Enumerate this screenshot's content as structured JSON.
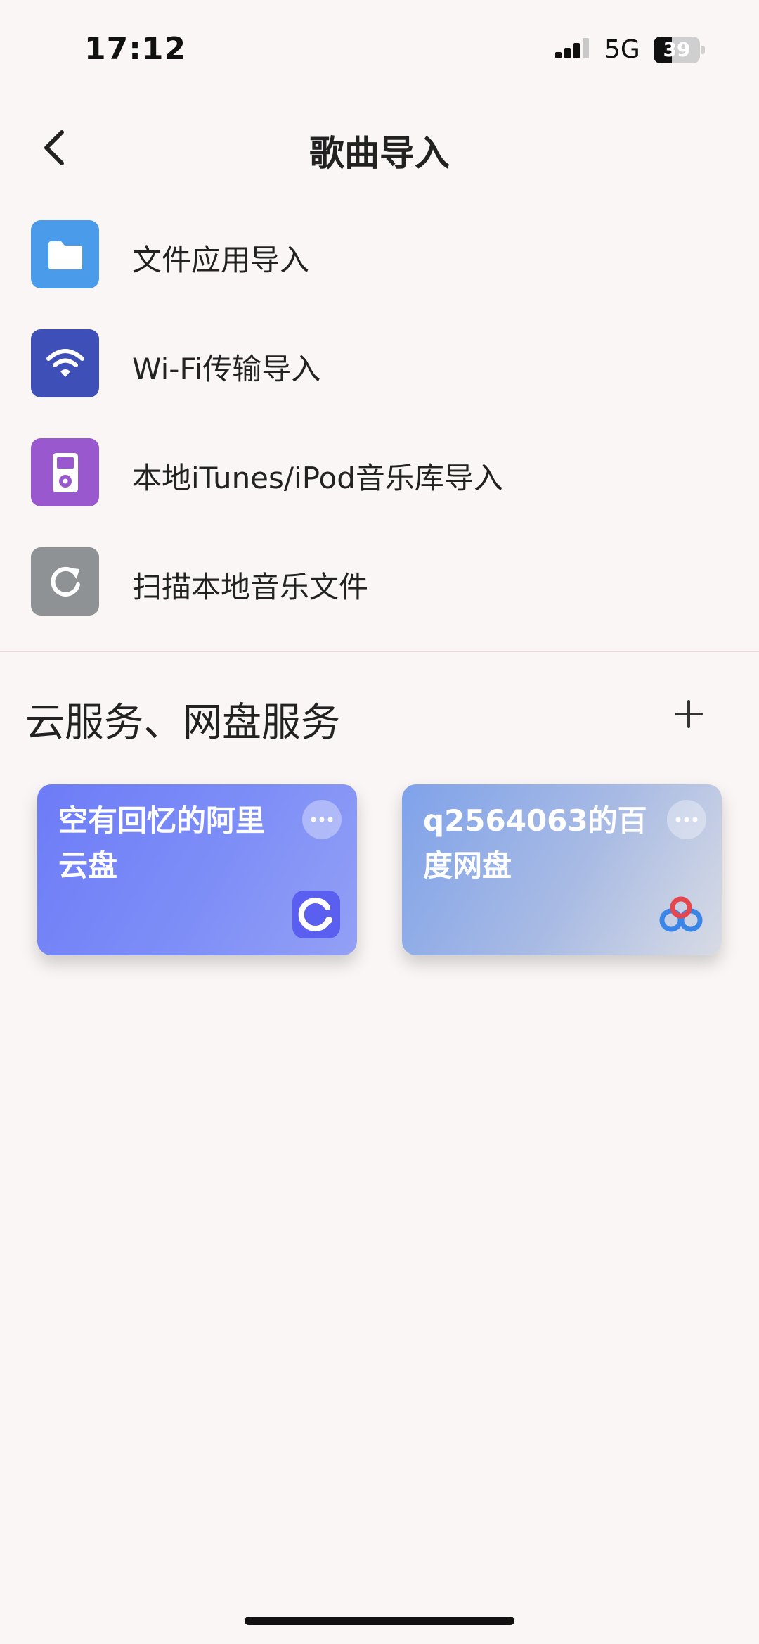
{
  "status_bar": {
    "time": "17:12",
    "network": "5G",
    "battery_level": "39",
    "battery_fraction": 0.39
  },
  "header": {
    "title": "歌曲导入",
    "back_icon": "chevron-left-icon"
  },
  "import_options": [
    {
      "label": "文件应用导入",
      "icon": "folder-icon",
      "color": "#4a9bea"
    },
    {
      "label": "Wi-Fi传输导入",
      "icon": "wifi-icon",
      "color": "#3f4fb8"
    },
    {
      "label": "本地iTunes/iPod音乐库导入",
      "icon": "ipod-icon",
      "color": "#9a58cf"
    },
    {
      "label": "扫描本地音乐文件",
      "icon": "refresh-icon",
      "color": "#8f9295"
    }
  ],
  "cloud_section": {
    "title": "云服务、网盘服务",
    "add_icon": "plus-icon",
    "services": [
      {
        "name": "空有回忆的阿里云盘",
        "logo": "aliyun-drive-logo",
        "more_icon": "more-icon"
      },
      {
        "name": "q2564063的百度网盘",
        "logo": "baidu-netdisk-logo",
        "more_icon": "more-icon"
      }
    ]
  },
  "colors": {
    "background": "#faf6f6",
    "aliyun_card": "#7080f6",
    "baidu_card": "#8fa9e8"
  }
}
